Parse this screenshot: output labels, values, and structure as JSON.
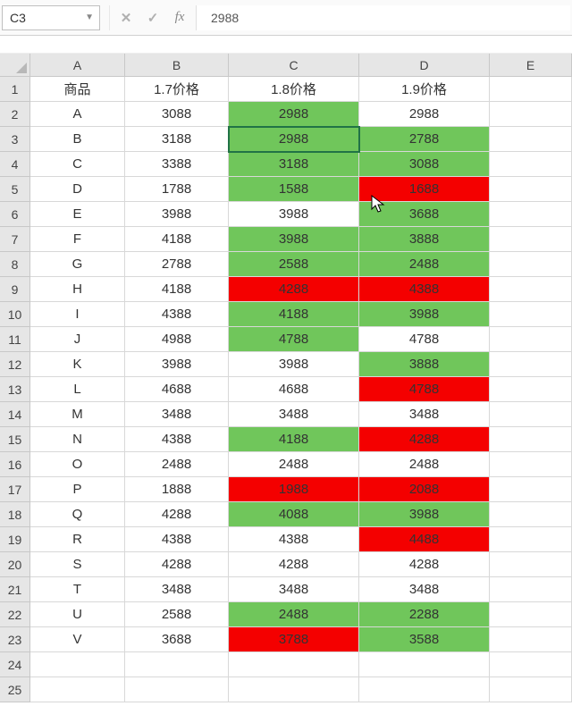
{
  "toolbar": {
    "name_box": "C3",
    "formula": "2988"
  },
  "columns": [
    "A",
    "B",
    "C",
    "D",
    "E"
  ],
  "row_count": 25,
  "headers": [
    "商品",
    "1.7价格",
    "1.8价格",
    "1.9价格"
  ],
  "rows": [
    {
      "a": "A",
      "b": "3088",
      "c": {
        "v": "2988",
        "f": "green"
      },
      "d": {
        "v": "2988",
        "f": ""
      }
    },
    {
      "a": "B",
      "b": "3188",
      "c": {
        "v": "2988",
        "f": "green"
      },
      "d": {
        "v": "2788",
        "f": "green"
      }
    },
    {
      "a": "C",
      "b": "3388",
      "c": {
        "v": "3188",
        "f": "green"
      },
      "d": {
        "v": "3088",
        "f": "green"
      }
    },
    {
      "a": "D",
      "b": "1788",
      "c": {
        "v": "1588",
        "f": "green"
      },
      "d": {
        "v": "1688",
        "f": "red"
      }
    },
    {
      "a": "E",
      "b": "3988",
      "c": {
        "v": "3988",
        "f": ""
      },
      "d": {
        "v": "3688",
        "f": "green"
      }
    },
    {
      "a": "F",
      "b": "4188",
      "c": {
        "v": "3988",
        "f": "green"
      },
      "d": {
        "v": "3888",
        "f": "green"
      }
    },
    {
      "a": "G",
      "b": "2788",
      "c": {
        "v": "2588",
        "f": "green"
      },
      "d": {
        "v": "2488",
        "f": "green"
      }
    },
    {
      "a": "H",
      "b": "4188",
      "c": {
        "v": "4288",
        "f": "red"
      },
      "d": {
        "v": "4388",
        "f": "red"
      }
    },
    {
      "a": "I",
      "b": "4388",
      "c": {
        "v": "4188",
        "f": "green"
      },
      "d": {
        "v": "3988",
        "f": "green"
      }
    },
    {
      "a": "J",
      "b": "4988",
      "c": {
        "v": "4788",
        "f": "green"
      },
      "d": {
        "v": "4788",
        "f": ""
      }
    },
    {
      "a": "K",
      "b": "3988",
      "c": {
        "v": "3988",
        "f": ""
      },
      "d": {
        "v": "3888",
        "f": "green"
      }
    },
    {
      "a": "L",
      "b": "4688",
      "c": {
        "v": "4688",
        "f": ""
      },
      "d": {
        "v": "4788",
        "f": "red"
      }
    },
    {
      "a": "M",
      "b": "3488",
      "c": {
        "v": "3488",
        "f": ""
      },
      "d": {
        "v": "3488",
        "f": ""
      }
    },
    {
      "a": "N",
      "b": "4388",
      "c": {
        "v": "4188",
        "f": "green"
      },
      "d": {
        "v": "4288",
        "f": "red"
      }
    },
    {
      "a": "O",
      "b": "2488",
      "c": {
        "v": "2488",
        "f": ""
      },
      "d": {
        "v": "2488",
        "f": ""
      }
    },
    {
      "a": "P",
      "b": "1888",
      "c": {
        "v": "1988",
        "f": "red"
      },
      "d": {
        "v": "2088",
        "f": "red"
      }
    },
    {
      "a": "Q",
      "b": "4288",
      "c": {
        "v": "4088",
        "f": "green"
      },
      "d": {
        "v": "3988",
        "f": "green"
      }
    },
    {
      "a": "R",
      "b": "4388",
      "c": {
        "v": "4388",
        "f": ""
      },
      "d": {
        "v": "4488",
        "f": "red"
      }
    },
    {
      "a": "S",
      "b": "4288",
      "c": {
        "v": "4288",
        "f": ""
      },
      "d": {
        "v": "4288",
        "f": ""
      }
    },
    {
      "a": "T",
      "b": "3488",
      "c": {
        "v": "3488",
        "f": ""
      },
      "d": {
        "v": "3488",
        "f": ""
      }
    },
    {
      "a": "U",
      "b": "2588",
      "c": {
        "v": "2488",
        "f": "green"
      },
      "d": {
        "v": "2288",
        "f": "green"
      }
    },
    {
      "a": "V",
      "b": "3688",
      "c": {
        "v": "3788",
        "f": "red"
      },
      "d": {
        "v": "3588",
        "f": "green"
      }
    }
  ],
  "selection": {
    "row": 3,
    "col": "C"
  },
  "cursor": {
    "row": 5,
    "col": "C"
  }
}
